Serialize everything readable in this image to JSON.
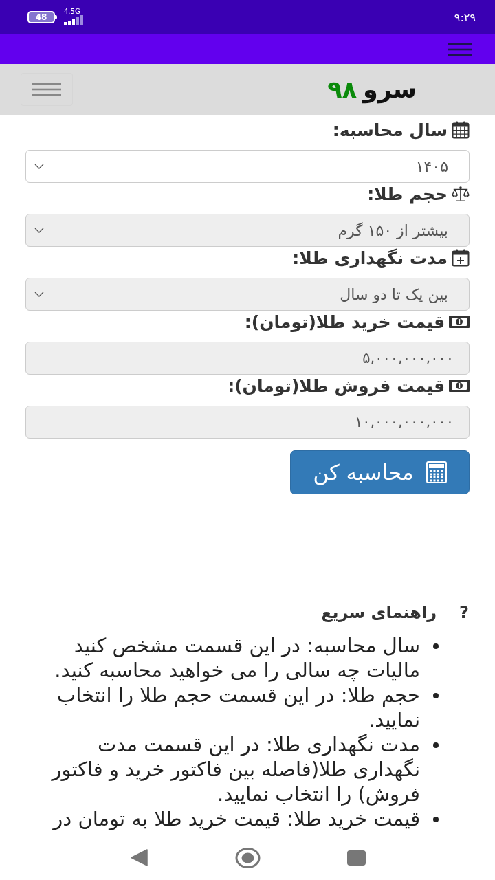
{
  "status_bar": {
    "battery": "48",
    "network": "4.5G",
    "time": "۹:۲۹"
  },
  "header": {
    "logo_text": "سرو",
    "logo_number": "۹۸"
  },
  "form": {
    "fields": [
      {
        "kind": "select",
        "label": "سال محاسبه:",
        "value": "۱۴۰۵",
        "disabled": false
      },
      {
        "kind": "select",
        "label": "حجم طلا:",
        "value": "بیشتر از ۱۵۰ گرم",
        "disabled": true
      },
      {
        "kind": "select",
        "label": "مدت نگهداری طلا:",
        "value": "بین یک تا دو سال",
        "disabled": true
      },
      {
        "kind": "input",
        "label": "قیمت خرید طلا(تومان):",
        "value": "۵,۰۰۰,۰۰۰,۰۰۰",
        "disabled": true
      },
      {
        "kind": "input",
        "label": "قیمت فروش طلا(تومان):",
        "value": "۱۰,۰۰۰,۰۰۰,۰۰۰",
        "disabled": true
      }
    ],
    "submit": "محاسبه کن"
  },
  "help": {
    "mark": "?",
    "title": "راهنمای سریع",
    "items": [
      "سال محاسبه: در این قسمت مشخص کنید مالیات چه سالی را می خواهید محاسبه کنید.",
      "حجم طلا: در این قسمت حجم طلا را انتخاب نمایید.",
      "مدت نگهداری طلا: در این قسمت مدت نگهداری طلا(فاصله بین فاکتور خرید و فاکتور فروش) را انتخاب نمایید.",
      "قیمت خرید طلا: قیمت خرید طلا به تومان در"
    ]
  }
}
